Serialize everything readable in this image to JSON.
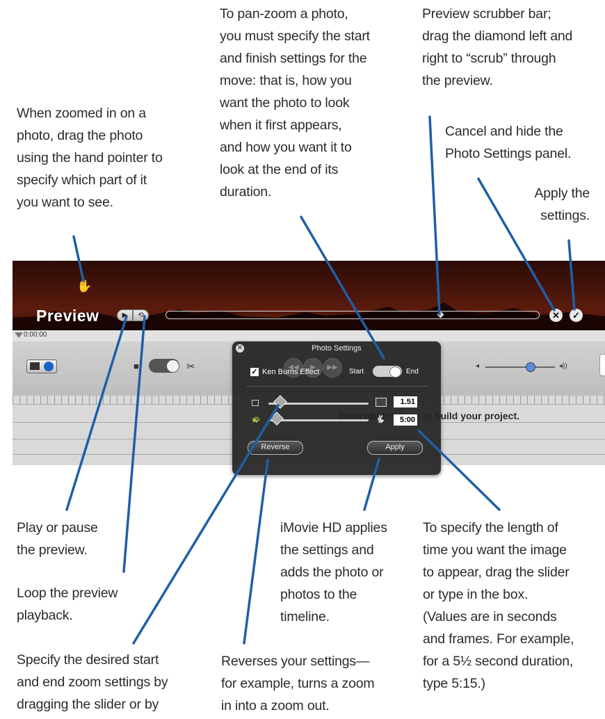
{
  "annotations": {
    "hand_pointer": [
      "When zoomed in on a",
      "photo, drag the photo",
      "using the hand pointer to",
      "specify which part of it",
      "you want to see."
    ],
    "pan_zoom": [
      "To pan-zoom a photo,",
      "you must specify the start",
      "and finish settings for the",
      "move: that is, how you",
      "want the photo to look",
      "when it first appears,",
      "and how you want it to",
      "look at the end of its",
      "duration."
    ],
    "scrubber": [
      "Preview scrubber bar;",
      "drag the diamond left and",
      "right to “scrub” through",
      "the preview."
    ],
    "cancel": [
      "Cancel and hide the",
      "Photo Settings panel."
    ],
    "apply_settings": [
      "Apply the",
      "settings."
    ],
    "play_pause": [
      "Play or pause",
      "the preview."
    ],
    "loop": [
      "Loop the preview",
      "playback."
    ],
    "zoom": [
      "Specify the desired start",
      "and end zoom settings by",
      "dragging the slider or by"
    ],
    "imovie_applies": [
      "iMovie HD applies",
      "the settings and",
      "adds the photo or",
      "photos to the",
      "timeline."
    ],
    "reverse": [
      "Reverses your settings—",
      "for example, turns a zoom",
      "in into a zoom out."
    ],
    "duration": [
      "To specify the length of",
      "time you want the image",
      "to appear, drag the slider",
      "or type in the box.",
      "(Values are in seconds",
      "and frames. For example,",
      "for a 5½ second duration,",
      "type 5:15.)"
    ]
  },
  "preview": {
    "title": "Preview",
    "timecode": "0:00:00",
    "scrubber_position": 0.73
  },
  "photo_settings": {
    "title": "Photo Settings",
    "ken_burns_label": "Ken Burns Effect",
    "ken_burns_checked": true,
    "start_label": "Start",
    "end_label": "End",
    "zoom_value": "1.51",
    "duration_value": "5:00",
    "reverse_label": "Reverse",
    "apply_label": "Apply"
  },
  "timeline": {
    "dropzone_text": "Drag photos here to build your project."
  },
  "icons": {
    "hand": "hand-pointer-icon",
    "play": "play-icon",
    "loop": "loop-icon",
    "cancel": "close-circle-icon",
    "apply": "checkmark-circle-icon",
    "camera": "camera-icon",
    "scissors": "scissors-icon",
    "volume": "speaker-icon"
  },
  "colors": {
    "leader": "#1f5fa6",
    "panel": "#232323",
    "preview_sky": "#4a150b"
  }
}
